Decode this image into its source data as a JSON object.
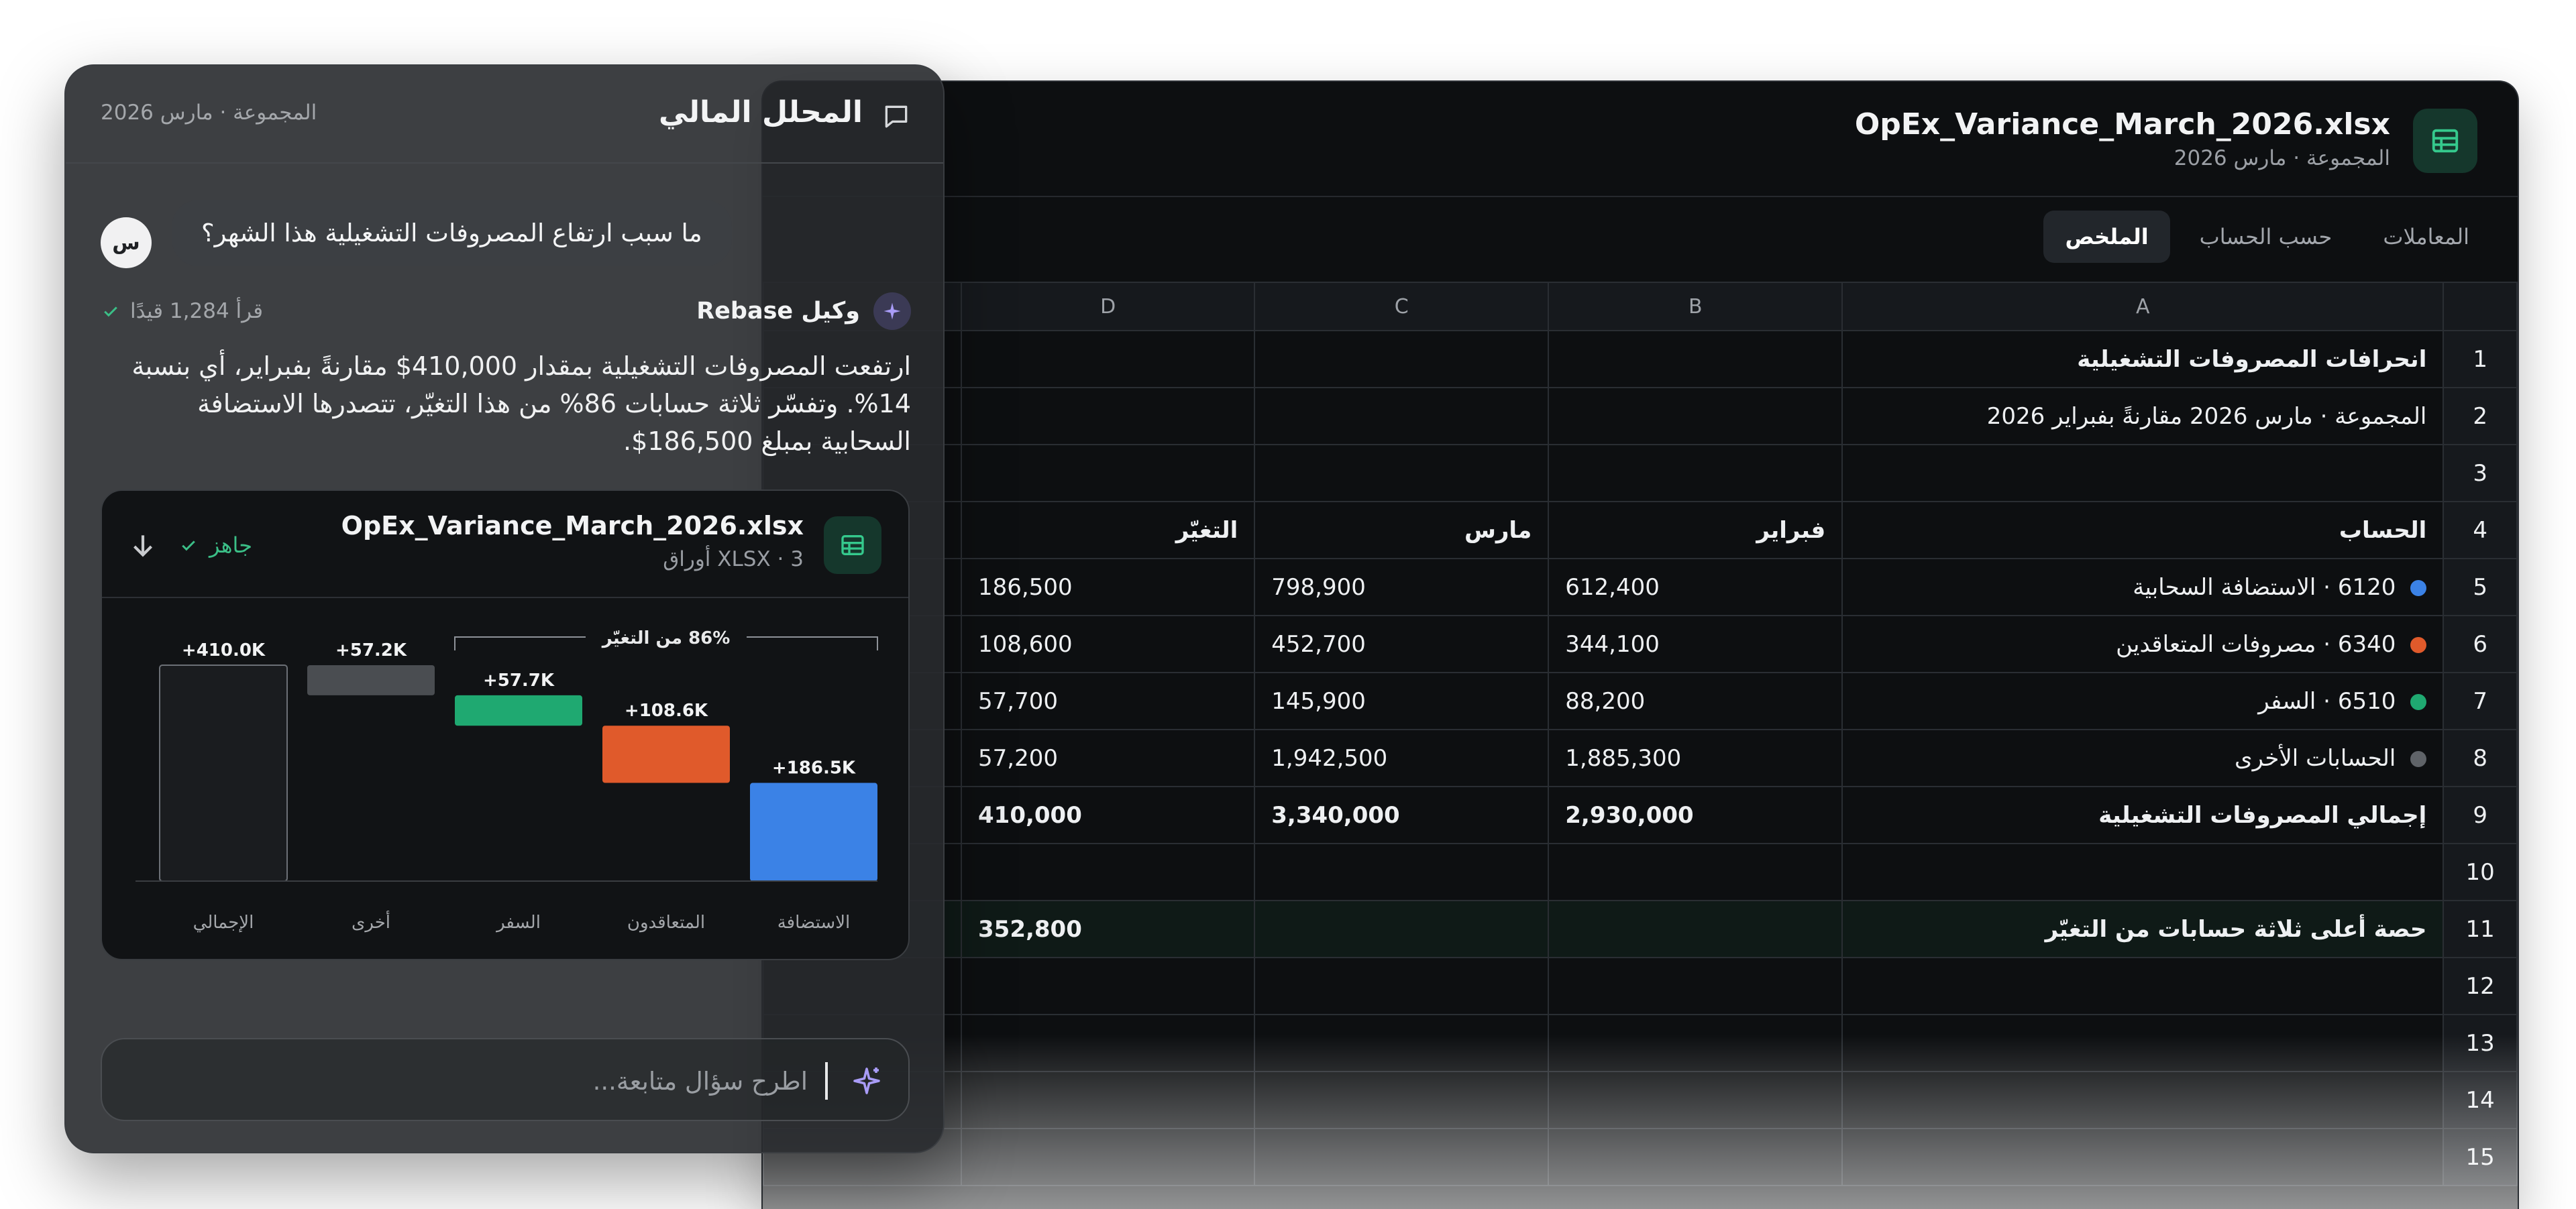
{
  "sheet": {
    "file_name": "OpEx_Variance_March_2026.xlsx",
    "subtitle": "المجموعة · مارس 2026",
    "tabs": [
      {
        "label": "الملخص",
        "active": true
      },
      {
        "label": "حسب الحساب",
        "active": false
      },
      {
        "label": "المعاملات",
        "active": false
      }
    ],
    "columns": [
      "A",
      "B",
      "C",
      "D"
    ],
    "rows": [
      {
        "num": "1",
        "a": "انحرافات المصروفات التشغيلية",
        "b": "",
        "c": "",
        "d": "",
        "style": "title"
      },
      {
        "num": "2",
        "a": "المجموعة · مارس 2026 مقارنةً بفبراير 2026",
        "b": "",
        "c": "",
        "d": "",
        "style": "sub"
      },
      {
        "num": "3",
        "a": "",
        "b": "",
        "c": "",
        "d": "",
        "style": ""
      },
      {
        "num": "4",
        "a": "الحساب",
        "b": "فبراير",
        "c": "مارس",
        "d": "التغيّر",
        "style": "header"
      },
      {
        "num": "5",
        "a": "6120 · الاستضافة السحابية",
        "b": "612,400",
        "c": "798,900",
        "d": "186,500",
        "style": "",
        "dot": "#3b82e6"
      },
      {
        "num": "6",
        "a": "6340 · مصروفات المتعاقدين",
        "b": "344,100",
        "c": "452,700",
        "d": "108,600",
        "style": "",
        "dot": "#e05a2b"
      },
      {
        "num": "7",
        "a": "6510 · السفر",
        "b": "88,200",
        "c": "145,900",
        "d": "57,700",
        "style": "",
        "dot": "#1fa971"
      },
      {
        "num": "8",
        "a": "الحسابات الأخرى",
        "b": "1,885,300",
        "c": "1,942,500",
        "d": "57,200",
        "style": "",
        "dot": "#5f6368"
      },
      {
        "num": "9",
        "a": "إجمالي المصروفات التشغيلية",
        "b": "2,930,000",
        "c": "3,340,000",
        "d": "410,000",
        "style": "bold"
      },
      {
        "num": "10",
        "a": "",
        "b": "",
        "c": "",
        "d": "",
        "style": ""
      },
      {
        "num": "11",
        "a": "حصة أعلى ثلاثة حسابات من التغيّر",
        "b": "",
        "c": "",
        "d": "352,800",
        "style": "highlight"
      },
      {
        "num": "12",
        "a": "",
        "b": "",
        "c": "",
        "d": "",
        "style": ""
      },
      {
        "num": "13",
        "a": "",
        "b": "",
        "c": "",
        "d": "",
        "style": ""
      },
      {
        "num": "14",
        "a": "",
        "b": "",
        "c": "",
        "d": "",
        "style": ""
      },
      {
        "num": "15",
        "a": "",
        "b": "",
        "c": "",
        "d": "",
        "style": ""
      }
    ]
  },
  "chat": {
    "title": "المحلل المالي",
    "context": "المجموعة · مارس 2026",
    "user_avatar": "س",
    "user_message": "ما سبب ارتفاع المصروفات التشغيلية هذا الشهر؟",
    "agent_name": "وكيل Rebase",
    "read_status": "قرأ 1,284 قيدًا",
    "agent_message": "ارتفعت المصروفات التشغيلية بمقدار 410,000$ مقارنةً بفبراير، أي بنسبة 14%. وتفسّر ثلاثة حسابات 86% من هذا التغيّر، تتصدرها الاستضافة السحابية بمبلغ 186,500$.",
    "attachment": {
      "file_name": "OpEx_Variance_March_2026.xlsx",
      "meta": "XLSX · 3 أوراق",
      "status": "جاهز"
    },
    "input_placeholder": "اطرح سؤال متابعة..."
  },
  "chart_data": {
    "type": "bar",
    "subtype": "waterfall",
    "categories": [
      "الاستضافة",
      "المتعاقدون",
      "السفر",
      "أخرى",
      "الإجمالي"
    ],
    "values": [
      186.5,
      108.6,
      57.7,
      57.2,
      410.0
    ],
    "value_labels": [
      "+186.5K",
      "+108.6K",
      "+57.7K",
      "+57.2K",
      "+410.0K"
    ],
    "colors": [
      "#3b82e6",
      "#e05a2b",
      "#1fa971",
      "#4a4d51",
      "#1a1c1f"
    ],
    "bracket_label": "86% من التغيّر",
    "ylim": [
      0,
      410
    ]
  }
}
